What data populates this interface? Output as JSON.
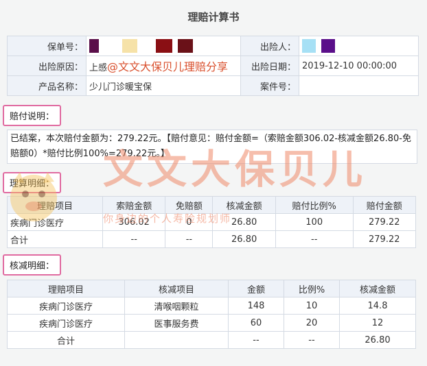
{
  "title": "理赔计算书",
  "info": {
    "policy_no_label": "保单号：",
    "insured_label": "出险人：",
    "reason_label": "出险原因：",
    "reason_value": "上感",
    "reason_watermark": "@文文大保贝儿理赔分享",
    "date_label": "出险日期：",
    "date_value": "2019-12-10 00:00:00",
    "product_label": "产品名称：",
    "product_value": "少儿门诊暖宝保",
    "case_label": "案件号："
  },
  "explain_section": {
    "label": "赔付说明：",
    "text": "已结案，本次赔付金额为：279.22元。【赔付意见：赔付金额=（索赔金额306.02-核减金额26.80-免赔额0）*赔付比例100%=279.22元。】"
  },
  "calc_section": {
    "label": "理算明细：",
    "headers": [
      "理赔项目",
      "索赔金额",
      "免赔额",
      "核减金额",
      "赔付比例%",
      "赔付金额"
    ],
    "rows": [
      [
        "疾病门诊医疗",
        "306.02",
        "0",
        "26.80",
        "100",
        "279.22"
      ],
      [
        "合计",
        "--",
        "--",
        "26.80",
        "--",
        "279.22"
      ]
    ]
  },
  "deduct_section": {
    "label": "核减明细：",
    "headers": [
      "理赔项目",
      "核减项目",
      "金额",
      "比例%",
      "核减金额"
    ],
    "rows": [
      [
        "疾病门诊医疗",
        "清喉咽颗粒",
        "148",
        "10",
        "14.8"
      ],
      [
        "疾病门诊医疗",
        "医事服务费",
        "60",
        "20",
        "12"
      ],
      [
        "合计",
        "",
        "--",
        "--",
        "26.80"
      ]
    ]
  },
  "watermark": {
    "main": "文文大保贝儿",
    "sub": "你身边的个人寿险规划师"
  },
  "colors": {
    "pink_border": "#e06aa0",
    "header_bg": "#eef2f8",
    "watermark": "#f08a6a",
    "redacted_1": "#5a0f4a",
    "redacted_2": "#f6e2a8",
    "redacted_3": "#8a0f14",
    "redacted_4": "#6a1118",
    "redacted_5": "#a6e0f5",
    "redacted_6": "#5a0f8a"
  }
}
